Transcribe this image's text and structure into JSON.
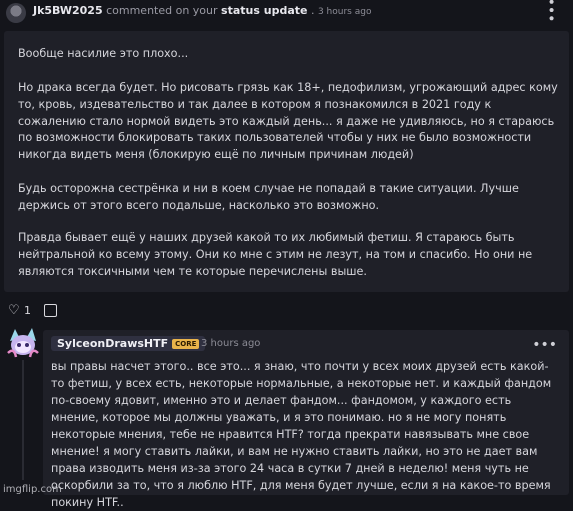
{
  "header": {
    "username": "Jk5BW2025",
    "action_text": "commented on your",
    "target_link": "status update",
    "separator": ".",
    "time": "3 hours ago",
    "menu_icon": "more-dots-icon"
  },
  "post": {
    "paragraphs": [
      "Вообще насилие это плохо...",
      "Но драка всегда будет. Но рисовать грязь как 18+, педофилизм, угрожающий адрес кому то, кровь, издевательство и так далее в котором я познакомился в 2021 году к сожалению стало нормой видеть это каждый день... я даже не удивляюсь, но я стараюсь по возможности блокировать таких пользователей чтобы у них не было возможности никогда видеть меня (блокирую ещё по личным причинам людей)",
      "Будь осторожна сестрёнка и ни в коем случае не попадай в такие ситуации. Лучше держись от этого всего подальше, насколько это возможно.",
      "Правда бывает ещё у наших друзей какой то их любимый фетиш. Я стараюсь быть нейтральной ко всему этому. Они ко мне с этим не лезут, на том и спасибо. Но они не являются токсичными чем те которые перечислены выше."
    ]
  },
  "actions": {
    "like_icon": "heart-icon",
    "like_count": "1",
    "reply_icon": "reply-icon"
  },
  "reply": {
    "username": "SylceonDrawsHTF",
    "badge": "CORE",
    "time": "3 hours ago",
    "menu_icon": "more-dots-icon",
    "body": "вы правы насчет этого.. все это... я знаю, что почти у всех моих друзей есть какой-то фетиш, у всех есть, некоторые нормальные, а некоторые нет. и каждый фандом по-своему ядовит, именно это и делает фандом... фандомом, у каждого есть мнение, которое мы должны уважать, и я это понимаю. но я не могу понять некоторые мнения, тебе не нравится HTF? тогда прекрати навязывать мне свое мнение! я могу ставить лайки, и вам не нужно ставить лайки, но это не дает вам права изводить меня из-за этого 24 часа в сутки 7 дней в неделю! меня чуть не оскорбили за то, что я люблю HTF, для меня будет лучше, если я на какое-то время покину HTF.."
  },
  "watermark": "imgflip.com"
}
